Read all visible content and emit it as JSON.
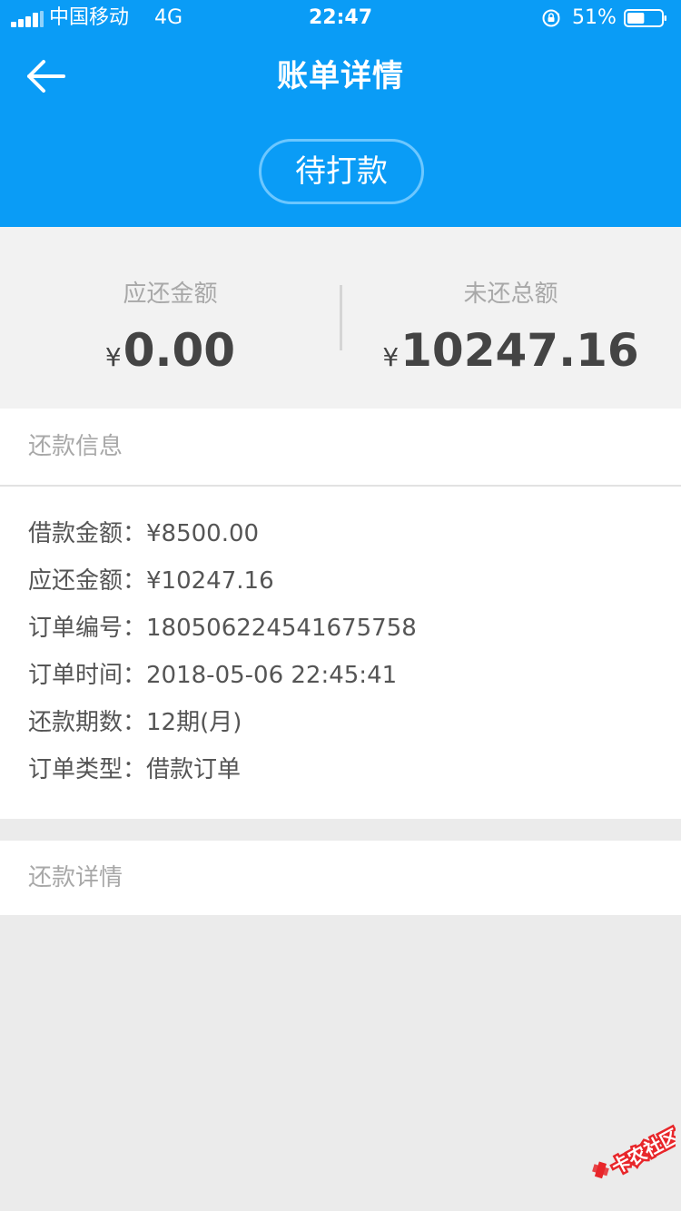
{
  "status_bar": {
    "carrier": "中国移动",
    "network": "4G",
    "time": "22:47",
    "battery": "51%",
    "battery_level": 0.51
  },
  "nav": {
    "title": "账单详情",
    "back_icon": "arrow-left-icon"
  },
  "status_badge": "待打款",
  "summary": {
    "due": {
      "label": "应还金额",
      "currency": "¥",
      "amount": "0.00"
    },
    "outstanding": {
      "label": "未还总额",
      "currency": "¥",
      "amount": "10247.16"
    }
  },
  "repayment_info": {
    "title": "还款信息",
    "rows": [
      {
        "label": "借款金额：",
        "value": "¥8500.00"
      },
      {
        "label": "应还金额：",
        "value": "¥10247.16"
      },
      {
        "label": "订单编号：",
        "value": "180506224541675758"
      },
      {
        "label": "订单时间：",
        "value": "2018-05-06 22:45:41"
      },
      {
        "label": "还款期数：",
        "value": "12期(月)"
      },
      {
        "label": "订单类型：",
        "value": "借款订单"
      }
    ]
  },
  "repayment_details": {
    "title": "还款详情"
  },
  "watermark": {
    "text": "卡农社区",
    "color": "#e8262a"
  },
  "colors": {
    "header": "#0a9cf6",
    "pill_border": "#6cc7ff"
  }
}
